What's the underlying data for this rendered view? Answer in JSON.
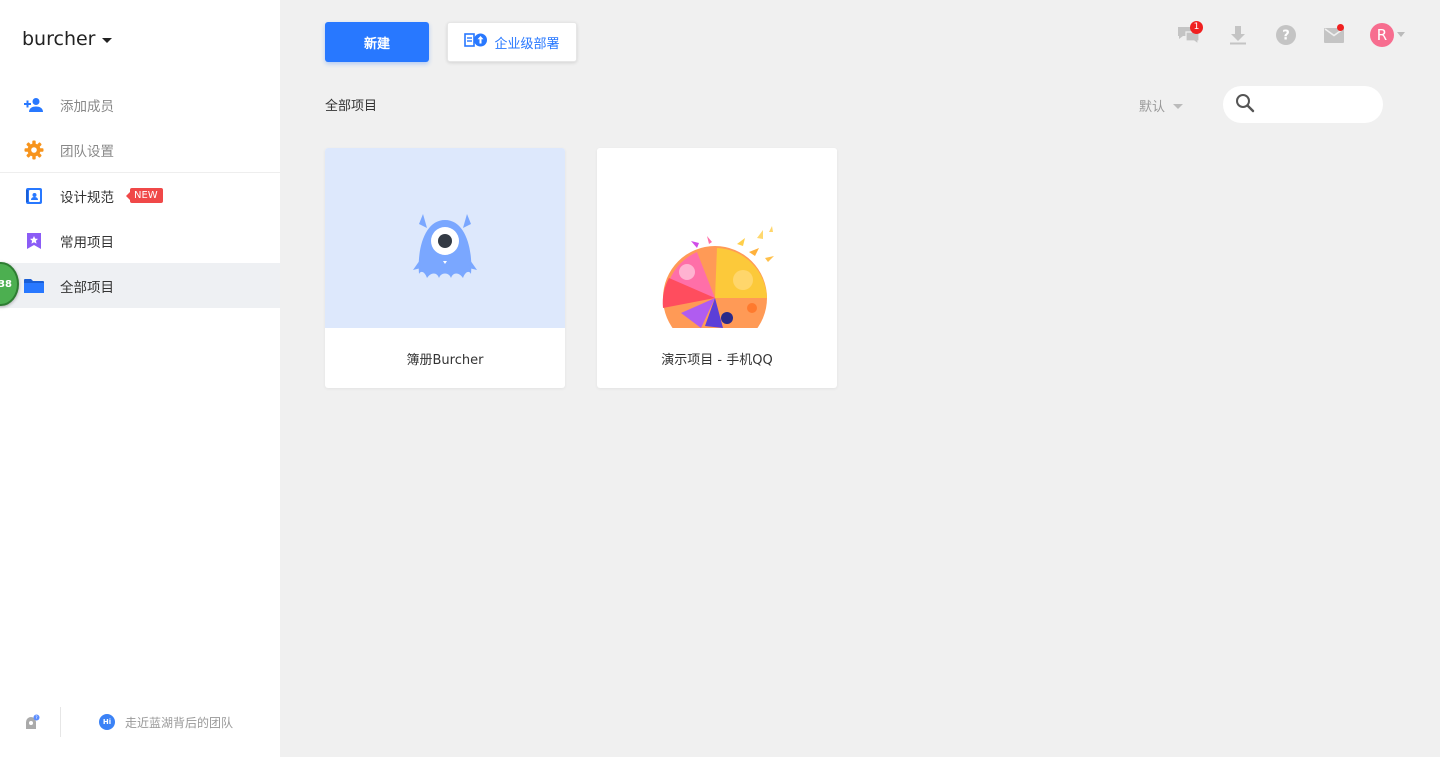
{
  "sidebar": {
    "team_name": "burcher",
    "items": [
      {
        "label": "添加成员",
        "icon": "add-user-icon"
      },
      {
        "label": "团队设置",
        "icon": "gear-icon"
      },
      {
        "label": "设计规范",
        "icon": "design-spec-icon",
        "badge": "NEW"
      },
      {
        "label": "常用项目",
        "icon": "star-bookmark-icon"
      },
      {
        "label": "全部项目",
        "icon": "folder-icon"
      }
    ],
    "floating_badge": "38",
    "footer_link": "走近蓝湖背后的团队",
    "footer_hi": "Hi"
  },
  "toolbar": {
    "new_label": "新建",
    "enterprise_label": "企业级部署"
  },
  "header_icons": {
    "message_count": "1",
    "avatar_letter": "R",
    "icons": [
      "chat-bubbles-icon",
      "download-icon",
      "help-icon",
      "mail-icon"
    ]
  },
  "main": {
    "section_title": "全部项目",
    "sort_label": "默认",
    "search_placeholder": ""
  },
  "projects": [
    {
      "name": "簿册Burcher"
    },
    {
      "name": "演示项目 - 手机QQ"
    }
  ],
  "colors": {
    "primary": "#2878ff",
    "sidebar_bg": "#ffffff",
    "page_bg": "#f0f0f0",
    "badge_red": "#f04848",
    "avatar": "#f76d8f",
    "thumb_blue": "#dde8fc"
  }
}
